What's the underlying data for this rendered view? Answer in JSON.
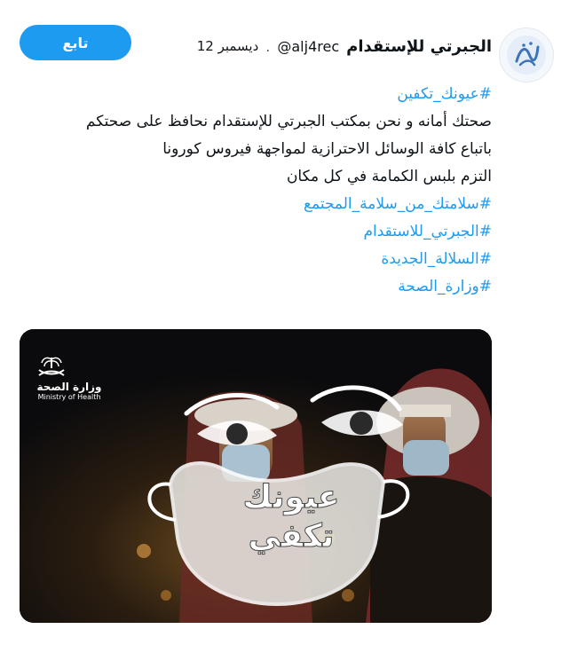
{
  "author": {
    "name": "الجبرتي للإستقدام",
    "handle": "@alj4rec",
    "separator": ".",
    "date": "12 ديسمبر",
    "avatar_icon": "calligraphy-logo-icon"
  },
  "follow_button": {
    "label": "تابع",
    "color": "#1d9bf0"
  },
  "tweet": {
    "line1": "#عيونك_تكفين",
    "line2": "صحتك أمانه و نحن بمكتب الجبرتي للإستقدام نحافظ على صحتكم",
    "line3": "باتباع كافة الوسائل الاحترازية لمواجهة فيروس كورونا",
    "line4": "التزم بلبس الكمامة في كل مكان",
    "line5": "#سلامتك_من_سلامة_المجتمع",
    "line6": "#الجبرتي_للاستقدام",
    "line7": "#السلالة_الجديدة",
    "line8": "#وزارة_الصحة"
  },
  "media": {
    "moh_logo_ar": "وزارة الصحة",
    "moh_logo_en": "Ministry of Health",
    "campaign_line1": "عيونك",
    "campaign_line2": "تكفي"
  },
  "colors": {
    "accent": "#1d9bf0",
    "text": "#0f1419"
  }
}
